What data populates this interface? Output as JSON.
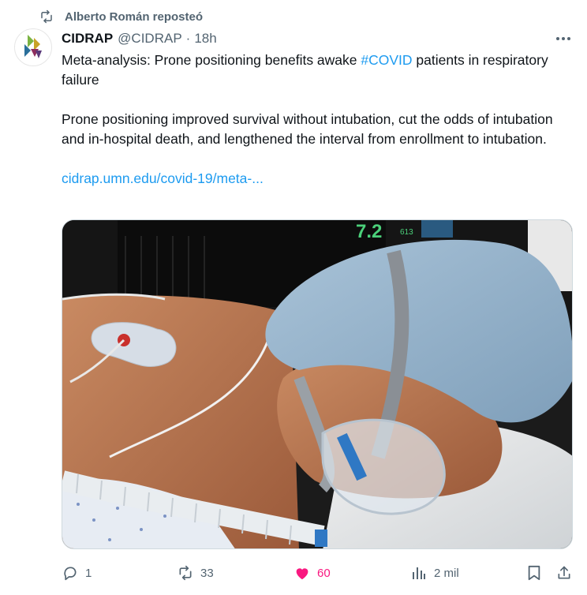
{
  "repost": {
    "text": "Alberto Román reposteó",
    "icon": "repost-icon"
  },
  "author": {
    "name": "CIDRAP",
    "handle": "@CIDRAP",
    "separator": "·",
    "time": "18h",
    "avatar_icon": "cidrap-logo"
  },
  "tweet": {
    "line1_before": "Meta-analysis: Prone positioning benefits awake ",
    "hashtag": "#COVID",
    "line1_after": " patients in respiratory failure",
    "paragraph2": "Prone positioning improved survival without intubation, cut the odds of intubation and in-hospital death, and lengthened the interval from enrollment to intubation.",
    "link": "cidrap.umn.edu/covid-19/meta-..."
  },
  "media": {
    "description_icon": "photo-patient-prone-positioning",
    "monitor_values": [
      "7.2",
      "613"
    ]
  },
  "actions": {
    "replies": "1",
    "reposts": "33",
    "likes": "60",
    "views": "2 mil"
  },
  "colors": {
    "accent": "#1d9bf0",
    "like": "#f91880",
    "muted": "#536471",
    "text": "#0f1419"
  }
}
